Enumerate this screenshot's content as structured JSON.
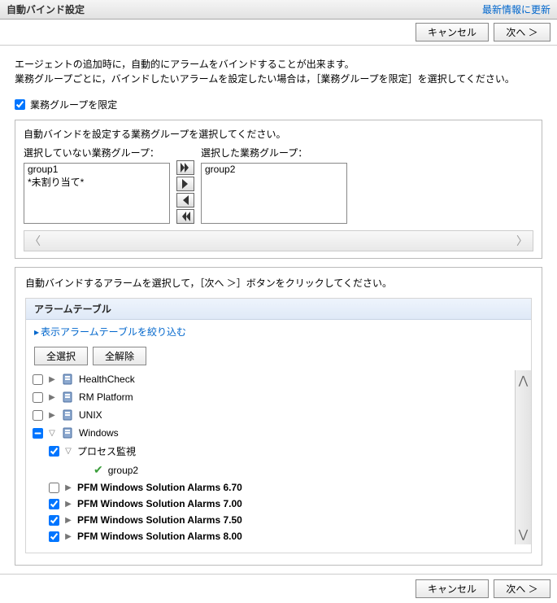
{
  "header": {
    "title": "自動バインド設定",
    "refresh_link": "最新情報に更新"
  },
  "toolbar": {
    "cancel": "キャンセル",
    "next": "次へ ＞"
  },
  "desc": {
    "line1": "エージェントの追加時に，自動的にアラームをバインドすることが出来ます。",
    "line2": "業務グループごとに，バインドしたいアラームを設定したい場合は，［業務グループを限定］を選択してください。"
  },
  "limit_checkbox_label": "業務グループを限定",
  "groups_panel": {
    "title": "自動バインドを設定する業務グループを選択してください。",
    "unselected_label": "選択していない業務グループ：",
    "selected_label": "選択した業務グループ：",
    "unselected_items": [
      "group1",
      "*未割り当て*"
    ],
    "selected_items": [
      "group2"
    ]
  },
  "alarm_panel": {
    "instruction": "自動バインドするアラームを選択して，［次へ ＞］ボタンをクリックしてください。",
    "table_header": "アラームテーブル",
    "filter_label": "表示アラームテーブルを絞り込む",
    "select_all": "全選択",
    "deselect_all": "全解除",
    "tree": [
      {
        "checked": false,
        "caret": "▶",
        "icon": "server-icon",
        "label": "HealthCheck",
        "bold": false,
        "indent": 0
      },
      {
        "checked": false,
        "caret": "▶",
        "icon": "server-icon",
        "label": "RM Platform",
        "bold": false,
        "indent": 0
      },
      {
        "checked": false,
        "caret": "▶",
        "icon": "server-icon",
        "label": "UNIX",
        "bold": false,
        "indent": 0
      },
      {
        "checked": "indeterminate",
        "caret": "▽",
        "icon": "server-icon",
        "label": "Windows",
        "bold": false,
        "indent": 0
      },
      {
        "checked": true,
        "caret": "▽",
        "icon": "",
        "label": "プロセス監視",
        "bold": false,
        "indent": 1
      },
      {
        "checked": "none",
        "caret": "",
        "icon": "check-icon",
        "label": "group2",
        "bold": false,
        "indent": 2
      },
      {
        "checked": false,
        "caret": "▶",
        "icon": "",
        "label": "PFM Windows Solution Alarms 6.70",
        "bold": true,
        "indent": 1
      },
      {
        "checked": true,
        "caret": "▶",
        "icon": "",
        "label": "PFM Windows Solution Alarms 7.00",
        "bold": true,
        "indent": 1
      },
      {
        "checked": true,
        "caret": "▶",
        "icon": "",
        "label": "PFM Windows Solution Alarms 7.50",
        "bold": true,
        "indent": 1
      },
      {
        "checked": true,
        "caret": "▶",
        "icon": "",
        "label": "PFM Windows Solution Alarms 8.00",
        "bold": true,
        "indent": 1
      }
    ]
  },
  "footer": {
    "cancel": "キャンセル",
    "next": "次へ ＞"
  }
}
